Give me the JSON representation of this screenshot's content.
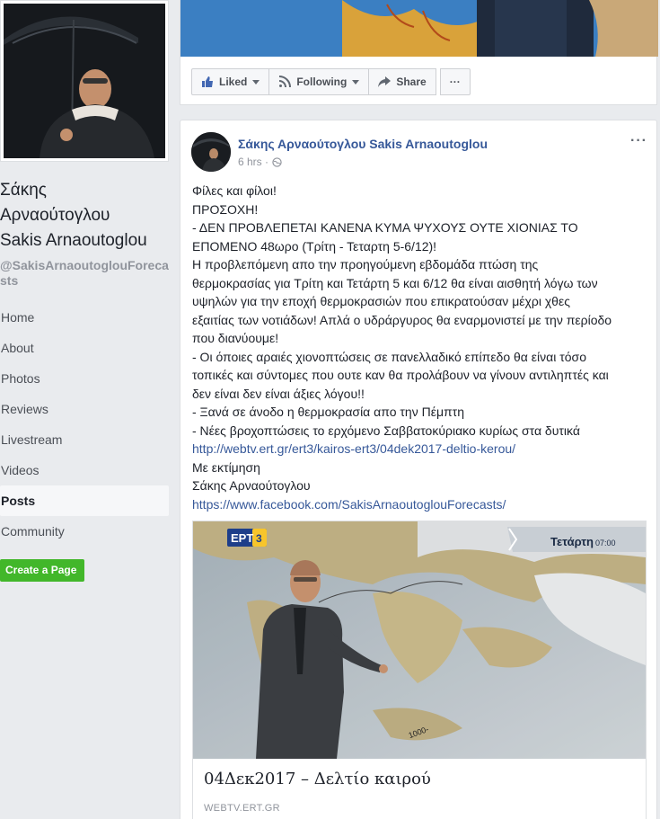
{
  "sidebar": {
    "page_name_line1": "Σάκης",
    "page_name_line2": "Αρναούτογλου",
    "page_name_line3": "Sakis Arnaoutoglou",
    "handle": "@SakisArnaoutoglouForecasts",
    "nav": [
      "Home",
      "About",
      "Photos",
      "Reviews",
      "Livestream",
      "Videos",
      "Posts",
      "Community"
    ],
    "active_nav": "Posts",
    "create_page_label": "Create a Page"
  },
  "prev_post": {
    "actions": {
      "liked": "Liked",
      "following": "Following",
      "share": "Share",
      "more": "···"
    }
  },
  "post": {
    "author": "Σάκης Αρναούτογλου Sakis Arnaoutoglou",
    "time": "6 hrs ·",
    "menu": "···",
    "lines": [
      "Φίλες και φίλοι!",
      "ΠΡΟΣΟΧΗ!",
      "- ΔΕΝ ΠΡΟΒΛΕΠΕΤΑΙ ΚΑΝΕΝΑ ΚΥΜΑ ΨΥΧΟΥΣ ΟΥΤΕ ΧΙΟΝΙΑΣ ΤΟ",
      "ΕΠΟΜΕΝΟ 48ωρο (Τρίτη - Τεταρτη 5-6/12)!",
      "Η προβλεπόμενη απο την προηγούμενη εβδομάδα πτώση της",
      "θερμοκρασίας για Τρίτη και Τετάρτη 5 και 6/12 θα είναι αισθητή λόγω των",
      "υψηλών για την εποχή θερμοκρασιών που επικρατούσαν μέχρι χθες",
      "εξαιτίας των νοτιάδων! Απλά ο υδράργυρος θα εναρμονιστεί με την περίοδο",
      "που διανύουμε!",
      "- Οι όποιες αραιές χιονοπτώσεις σε πανελλαδικό επίπεδο θα είναι τόσο",
      "τοπικές και σύντομες που ουτε καν θα προλάβουν να γίνουν αντιληπτές και",
      "δεν είναι δεν είναι άξιες λόγου!!",
      "- Ξανά σε άνοδο η θερμοκρασία απο την Πέμπτη",
      "- Νέες βροχοπτώσεις το ερχόμενο Σαββατοκύριακο κυρίως στα δυτικά"
    ],
    "link1": "http://webtv.ert.gr/ert3/kairos-ert3/04dek2017-deltio-kerou/",
    "sign1": "Με εκτίμηση",
    "sign2": "Σάκης Αρναούτογλου",
    "link2": "https://www.facebook.com/SakisArnaoutoglouForecasts/"
  },
  "link_card": {
    "tv_logo": "ΕΡΤ",
    "tv_channel": "3",
    "day_label": "Τετάρτη",
    "clock": "07:00",
    "map_label": "1000-",
    "title": "04Δεκ2017 – Δελτίο καιρού",
    "domain": "WEBTV.ERT.GR"
  }
}
